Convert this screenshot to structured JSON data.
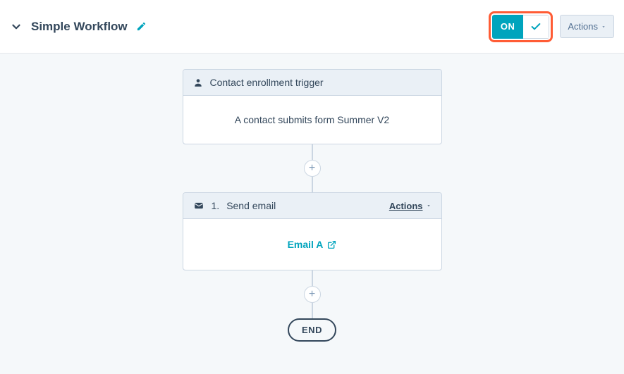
{
  "header": {
    "title": "Simple Workflow",
    "toggle_state": "ON",
    "actions_label": "Actions"
  },
  "trigger": {
    "header": "Contact enrollment trigger",
    "body": "A contact submits form Summer V2"
  },
  "step1": {
    "number": "1.",
    "title": "Send email",
    "actions_label": "Actions",
    "link_text": "Email A"
  },
  "end_label": "END"
}
